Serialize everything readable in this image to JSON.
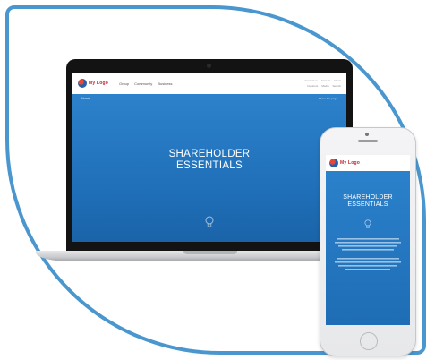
{
  "brand": {
    "logo_text": "My Logo",
    "logo_color": "#c1272d",
    "frame_color": "#4a97cf",
    "hero_color": "#2a7cc5"
  },
  "laptop": {
    "nav": [
      "Group",
      "Community",
      "Business"
    ],
    "util_top": [
      "Contact us",
      "Careers",
      "News"
    ],
    "util_bottom": [
      "Investors",
      "Media",
      "Search"
    ],
    "crumb": "Home",
    "share": "Share this page",
    "hero_line1": "SHAREHOLDER",
    "hero_line2": "ESSENTIALS",
    "hero_icon": "lightbulb-icon"
  },
  "phone": {
    "hero_line1": "SHAREHOLDER",
    "hero_line2": "ESSENTIALS",
    "hero_icon": "lightbulb-icon"
  }
}
